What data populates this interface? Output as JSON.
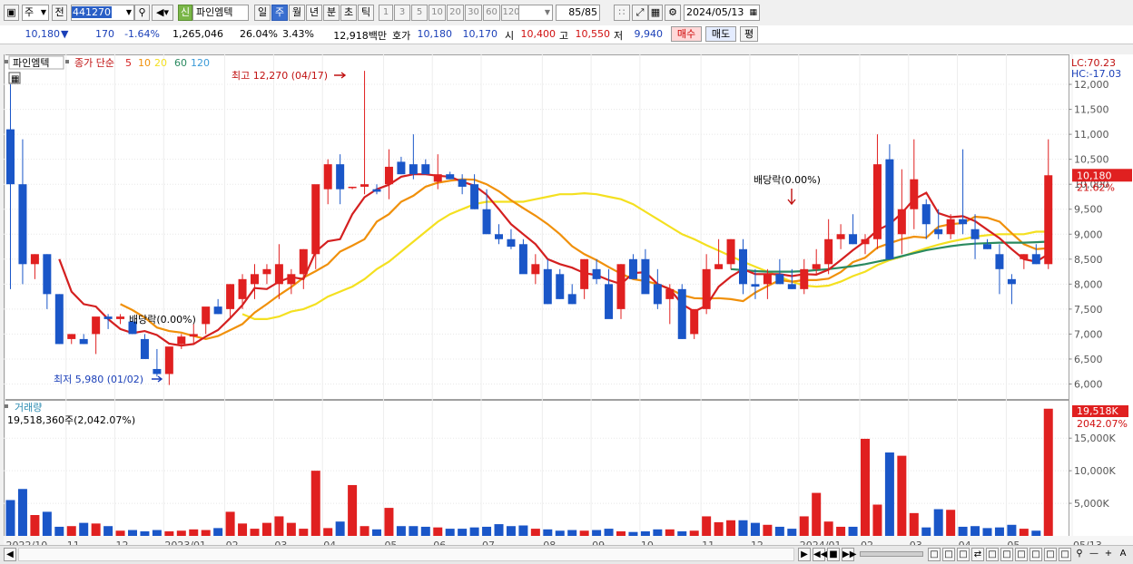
{
  "toolbar": {
    "market": "주",
    "prev_label": "전",
    "code": "441270",
    "new_badge": "신",
    "stock_name": "파인엠텍",
    "periods": [
      "일",
      "주",
      "월",
      "년",
      "분",
      "초",
      "틱"
    ],
    "selected_period": "주",
    "numbers": [
      "1",
      "3",
      "5",
      "10",
      "20",
      "30",
      "60",
      "120"
    ],
    "count": "85/85",
    "date": "2024/05/13"
  },
  "quote": {
    "price": "10,180",
    "arrow": "▼",
    "change": "170",
    "change_pct": "-1.64%",
    "volume": "1,265,046",
    "turnover_pct": "26.04%",
    "pct2": "3.43%",
    "amount": "12,918백만",
    "bid_label": "호가",
    "bid1": "10,180",
    "bid2": "10,170",
    "open_label": "시",
    "open": "10,400",
    "high_label": "고",
    "high": "10,550",
    "low_label": "저",
    "low": "9,940",
    "buy_label": "매수",
    "sell_label": "매도",
    "eval_label": "평"
  },
  "legend": {
    "name": "파인엠텍",
    "ma_label": "종가 단순",
    "ma_periods": [
      "5",
      "10",
      "20",
      "60",
      "120"
    ],
    "ma_colors": [
      "#d42020",
      "#f0900a",
      "#f4e020",
      "#2a8a60",
      "#3a9ad8"
    ]
  },
  "annotations": {
    "lc": "LC:70.23",
    "hc": "HC:-17.03",
    "max_label": "최고 12,270 (04/17)",
    "min_label": "최저 5,980 (01/02)",
    "div1": "배당락(0.00%)",
    "div2": "배당락(0.00%)",
    "price_tag": "10,180",
    "pct_tag": "21.62%",
    "vol_title": "거래량",
    "vol_value": "19,518,360주(2,042.07%)",
    "vol_tag": "19,518K",
    "vol_pct_tag": "2042.07%"
  },
  "colors": {
    "up": "#e02020",
    "down": "#1a56c8",
    "ma5": "#d42020",
    "ma10": "#f0900a",
    "ma20": "#f4e020",
    "ma60": "#2a8a60"
  },
  "chart_data": {
    "type": "candlestick",
    "price_axis": {
      "ticks": [
        "12,000",
        "11,500",
        "11,000",
        "10,500",
        "10,000",
        "9,500",
        "9,000",
        "8,500",
        "8,000",
        "7,500",
        "7,000",
        "6,500",
        "6,000"
      ],
      "ylim": [
        5700,
        12600
      ]
    },
    "volume_axis": {
      "ticks": [
        "15,000K",
        "10,000K",
        "5,000K"
      ],
      "ylim": [
        0,
        19900
      ]
    },
    "x_labels": [
      "2022/10",
      "11",
      "12",
      "2023/01",
      "02",
      "03",
      "04",
      "05",
      "06",
      "07",
      "08",
      "09",
      "10",
      "11",
      "12",
      "2024/01",
      "02",
      "03",
      "04",
      "05",
      "05/13"
    ],
    "candles": [
      [
        11100,
        12000,
        7900,
        10000
      ],
      [
        10000,
        10900,
        8000,
        8400
      ],
      [
        8400,
        8600,
        8100,
        8600
      ],
      [
        8600,
        8600,
        7500,
        7800
      ],
      [
        7800,
        7800,
        6800,
        6800
      ],
      [
        6900,
        7000,
        6800,
        7000
      ],
      [
        6900,
        7000,
        6800,
        6800
      ],
      [
        7000,
        7300,
        6600,
        7350
      ],
      [
        7350,
        7400,
        7100,
        7300
      ],
      [
        7300,
        7400,
        7200,
        7350
      ],
      [
        7250,
        7300,
        7000,
        7000
      ],
      [
        6900,
        7000,
        6500,
        6500
      ],
      [
        6300,
        6700,
        6150,
        6200
      ],
      [
        6200,
        6600,
        5980,
        6750
      ],
      [
        6800,
        7000,
        6700,
        6950
      ],
      [
        6950,
        7200,
        6800,
        7000
      ],
      [
        7200,
        7500,
        7000,
        7550
      ],
      [
        7550,
        7700,
        7400,
        7400
      ],
      [
        7500,
        8000,
        7300,
        8000
      ],
      [
        7700,
        8200,
        7500,
        8100
      ],
      [
        8000,
        8400,
        7700,
        8200
      ],
      [
        8200,
        8400,
        8000,
        8300
      ],
      [
        8000,
        8800,
        7700,
        8400
      ],
      [
        8000,
        8300,
        7800,
        8200
      ],
      [
        8200,
        8700,
        7900,
        8700
      ],
      [
        8600,
        9000,
        8300,
        10000
      ],
      [
        9900,
        10500,
        9600,
        10400
      ],
      [
        10400,
        10600,
        9600,
        9900
      ],
      [
        9950,
        9950,
        9900,
        9950
      ],
      [
        9950,
        12270,
        9800,
        10000
      ],
      [
        9900,
        10000,
        9800,
        9850
      ],
      [
        10000,
        10700,
        9700,
        10350
      ],
      [
        10450,
        10550,
        10200,
        10200
      ],
      [
        10400,
        11000,
        10100,
        10200
      ],
      [
        10400,
        10500,
        10200,
        10200
      ],
      [
        10050,
        10600,
        9900,
        10200
      ],
      [
        10200,
        10250,
        10100,
        10100
      ],
      [
        10100,
        10200,
        9800,
        9950
      ],
      [
        10000,
        10200,
        9500,
        9500
      ],
      [
        9500,
        9900,
        9200,
        9000
      ],
      [
        9000,
        9200,
        8800,
        8900
      ],
      [
        8900,
        9100,
        8700,
        8750
      ],
      [
        8800,
        8900,
        8400,
        8200
      ],
      [
        8200,
        8600,
        8000,
        8400
      ],
      [
        8300,
        8500,
        7600,
        7600
      ],
      [
        8200,
        8300,
        7700,
        7700
      ],
      [
        7800,
        8000,
        7600,
        7600
      ],
      [
        7900,
        8100,
        7700,
        8500
      ],
      [
        8300,
        8500,
        8000,
        8100
      ],
      [
        8000,
        8300,
        7500,
        7300
      ],
      [
        7500,
        8400,
        7300,
        8400
      ],
      [
        8500,
        8600,
        8200,
        8100
      ],
      [
        8500,
        8700,
        8100,
        7800
      ],
      [
        8000,
        8300,
        7500,
        7600
      ],
      [
        7700,
        8000,
        7200,
        7900
      ],
      [
        7900,
        8000,
        6900,
        6900
      ],
      [
        7000,
        7100,
        6900,
        7500
      ],
      [
        7500,
        8600,
        7400,
        8300
      ],
      [
        8300,
        8900,
        8300,
        8400
      ],
      [
        8400,
        8900,
        8300,
        8900
      ],
      [
        8700,
        8900,
        7800,
        8000
      ],
      [
        8000,
        8300,
        7700,
        7950
      ],
      [
        8000,
        8300,
        7700,
        8200
      ],
      [
        8200,
        8500,
        8000,
        8000
      ],
      [
        8000,
        8300,
        7900,
        7900
      ],
      [
        7900,
        8500,
        7800,
        8300
      ],
      [
        8300,
        8700,
        8200,
        8400
      ],
      [
        8400,
        9300,
        8200,
        8900
      ],
      [
        8900,
        9200,
        8700,
        9000
      ],
      [
        9000,
        9400,
        8800,
        8800
      ],
      [
        8800,
        9000,
        8600,
        8900
      ],
      [
        8900,
        11000,
        8700,
        10400
      ],
      [
        10500,
        10800,
        8500,
        8500
      ],
      [
        9000,
        10300,
        8600,
        9500
      ],
      [
        9500,
        10900,
        9100,
        10100
      ],
      [
        9600,
        9700,
        8900,
        9200
      ],
      [
        9100,
        9500,
        8900,
        9000
      ],
      [
        9000,
        9400,
        8900,
        9300
      ],
      [
        9300,
        10700,
        9000,
        9200
      ],
      [
        9100,
        9400,
        8500,
        8900
      ],
      [
        8800,
        8900,
        8700,
        8700
      ],
      [
        8600,
        8800,
        7800,
        8300
      ],
      [
        8100,
        8200,
        7600,
        8000
      ],
      [
        8500,
        8600,
        8300,
        8600
      ],
      [
        8600,
        8800,
        8400,
        8400
      ],
      [
        8400,
        10900,
        8300,
        10180
      ]
    ],
    "volume": [
      5500,
      7200,
      3200,
      3700,
      1400,
      1500,
      2000,
      1900,
      1500,
      800,
      900,
      700,
      900,
      700,
      800,
      1000,
      900,
      1200,
      3700,
      1900,
      1100,
      2000,
      3000,
      2000,
      1100,
      10000,
      1200,
      2200,
      7800,
      1500,
      1000,
      4300,
      1500,
      1500,
      1400,
      1300,
      1100,
      1100,
      1300,
      1400,
      1800,
      1500,
      1600,
      1100,
      1000,
      800,
      900,
      800,
      900,
      1100,
      700,
      600,
      700,
      1000,
      1000,
      700,
      800,
      3000,
      2100,
      2400,
      2400,
      2000,
      1700,
      1400,
      1100,
      3000,
      6600,
      2200,
      1400,
      1400,
      14900,
      4800,
      12800,
      12300,
      3500,
      1300,
      4100,
      4000,
      1400,
      1500,
      1200,
      1300,
      1700,
      1100,
      800,
      19518
    ],
    "ma5": [
      null,
      null,
      null,
      null,
      8500,
      7850,
      7600,
      7550,
      7300,
      7100,
      7020,
      7060,
      6980,
      6810,
      6770,
      6800,
      6950,
      7080,
      7320,
      7580,
      7920,
      7900,
      8050,
      8140,
      8100,
      8650,
      8860,
      8900,
      9400,
      9740,
      9900,
      9990,
      10150,
      10200,
      10200,
      10170,
      10150,
      10050,
      9970,
      9790,
      9500,
      9200,
      9000,
      8800,
      8500,
      8400,
      8330,
      8220,
      8180,
      8080,
      8000,
      8220,
      8240,
      8000,
      7900,
      7600,
      7450,
      7570,
      7950,
      8150,
      8300,
      8200,
      8200,
      8200,
      8160,
      8200,
      8190,
      8290,
      8480,
      8680,
      8860,
      9080,
      9200,
      9420,
      9700,
      9830,
      9420,
      9340,
      9360,
      9260,
      9090,
      8920,
      8700,
      8500,
      8450,
      8600
    ],
    "ma10": [
      null,
      null,
      null,
      null,
      null,
      null,
      null,
      null,
      null,
      7600,
      7480,
      7330,
      7130,
      7060,
      7030,
      6960,
      6900,
      6960,
      7080,
      7200,
      7430,
      7600,
      7780,
      7940,
      8130,
      8260,
      8400,
      8650,
      8770,
      8900,
      9250,
      9400,
      9650,
      9770,
      9950,
      10030,
      10070,
      10100,
      10090,
      10000,
      9860,
      9680,
      9520,
      9370,
      9200,
      9000,
      8760,
      8600,
      8480,
      8340,
      8210,
      8100,
      8060,
      8000,
      7900,
      7780,
      7720,
      7710,
      7720,
      7700,
      7660,
      7830,
      7960,
      8080,
      8050,
      8080,
      8080,
      8110,
      8240,
      8440,
      8530,
      8730,
      8820,
      8900,
      8950,
      8930,
      9150,
      9200,
      9220,
      9350,
      9330,
      9250,
      9020,
      8800,
      8700,
      8720
    ],
    "ma20": [
      null,
      null,
      null,
      null,
      null,
      null,
      null,
      null,
      null,
      null,
      null,
      null,
      null,
      null,
      null,
      null,
      null,
      null,
      null,
      7400,
      7300,
      7300,
      7350,
      7450,
      7500,
      7600,
      7750,
      7850,
      7950,
      8100,
      8300,
      8450,
      8650,
      8850,
      9050,
      9250,
      9400,
      9500,
      9600,
      9650,
      9650,
      9650,
      9650,
      9700,
      9750,
      9800,
      9800,
      9820,
      9800,
      9750,
      9700,
      9600,
      9450,
      9300,
      9150,
      9000,
      8900,
      8780,
      8670,
      8560,
      8450,
      8350,
      8250,
      8150,
      8050,
      7970,
      7950,
      7970,
      8050,
      8160,
      8250,
      8380,
      8480,
      8550,
      8640,
      8720,
      8790,
      8850,
      8900,
      8950,
      8980,
      9000,
      9000,
      9000,
      9050,
      9050
    ],
    "ma60": [
      null,
      null,
      null,
      null,
      null,
      null,
      null,
      null,
      null,
      null,
      null,
      null,
      null,
      null,
      null,
      null,
      null,
      null,
      null,
      null,
      null,
      null,
      null,
      null,
      null,
      null,
      null,
      null,
      null,
      null,
      null,
      null,
      null,
      null,
      null,
      null,
      null,
      null,
      null,
      null,
      null,
      null,
      null,
      null,
      null,
      null,
      null,
      null,
      null,
      null,
      null,
      null,
      null,
      null,
      null,
      null,
      null,
      null,
      null,
      8300,
      8280,
      8260,
      8250,
      8250,
      8250,
      8260,
      8280,
      8300,
      8330,
      8360,
      8400,
      8450,
      8500,
      8560,
      8620,
      8680,
      8720,
      8760,
      8790,
      8810,
      8820,
      8830,
      8830,
      8830,
      8840,
      8850
    ]
  }
}
